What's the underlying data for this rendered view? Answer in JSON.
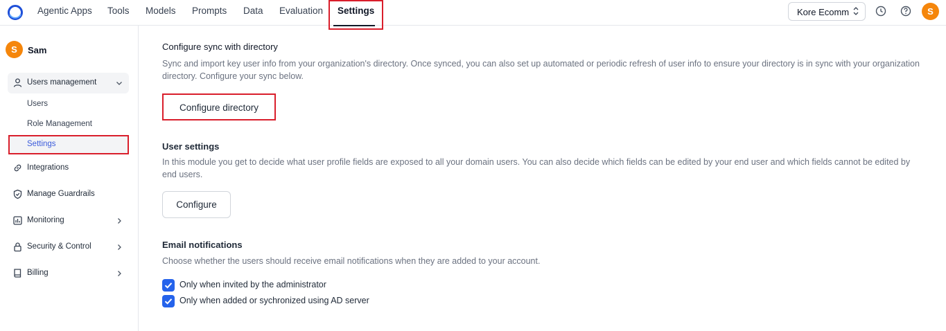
{
  "topnav": {
    "items": [
      "Agentic Apps",
      "Tools",
      "Models",
      "Prompts",
      "Data",
      "Evaluation",
      "Settings"
    ],
    "active": "Settings"
  },
  "workspace": {
    "selected": "Kore Ecomm"
  },
  "user": {
    "initial": "S",
    "name": "Sam"
  },
  "sidebar": {
    "group_label": "Users management",
    "sub_items": [
      "Users",
      "Role Management",
      "Settings"
    ],
    "items": [
      "Integrations",
      "Manage Guardrails",
      "Monitoring",
      "Security & Control",
      "Billing"
    ]
  },
  "sync": {
    "title": "Configure sync with directory",
    "description": "Sync and import key user info from your organization's directory. Once synced, you can also set up automated or periodic refresh of user info to ensure your directory is in sync with your organization directory. Configure your sync below.",
    "button": "Configure directory"
  },
  "user_settings": {
    "title": "User settings",
    "description": "In this module you get to decide what user profile fields are exposed to all your domain users. You can also decide which fields can be edited by your end user and which fields cannot be edited by end users.",
    "button": "Configure"
  },
  "email": {
    "title": "Email notifications",
    "description": "Choose whether the users should receive email notifications when they are added to your account.",
    "options": [
      {
        "label": "Only when invited by the administrator",
        "checked": true
      },
      {
        "label": "Only when added or sychronized using AD server",
        "checked": true
      }
    ]
  },
  "colors": {
    "accent": "#2563eb",
    "avatar": "#f5860b",
    "highlight": "#d91e2b"
  }
}
